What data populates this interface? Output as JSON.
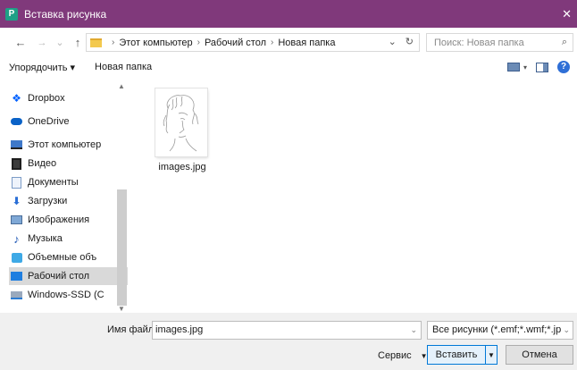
{
  "window": {
    "title": "Вставка рисунка",
    "app_icon_letter": "P",
    "close_glyph": "✕",
    "title_color": "#80397b"
  },
  "address": {
    "back_glyph": "←",
    "forward_glyph": "→",
    "recent_glyph": "⌄",
    "up_glyph": "↑",
    "crumbs": [
      "Этот компьютер",
      "Рабочий стол",
      "Новая папка"
    ],
    "separator": "›",
    "dropdown_glyph": "⌄",
    "refresh_glyph": "↻"
  },
  "search": {
    "placeholder": "Поиск: Новая папка",
    "icon": "⌕"
  },
  "toolbar": {
    "organize": "Упорядочить ▾",
    "new_folder": "Новая папка",
    "view_dd": "▾",
    "help": "?"
  },
  "sidebar": {
    "items": [
      {
        "label": "Dropbox",
        "icon": "dropbox-icon"
      },
      {
        "label": "OneDrive",
        "icon": "onedrive-icon"
      },
      {
        "label": "Этот компьютер",
        "icon": "computer-icon"
      },
      {
        "label": "Видео",
        "icon": "video-icon"
      },
      {
        "label": "Документы",
        "icon": "documents-icon"
      },
      {
        "label": "Загрузки",
        "icon": "downloads-icon"
      },
      {
        "label": "Изображения",
        "icon": "images-icon"
      },
      {
        "label": "Музыка",
        "icon": "music-icon"
      },
      {
        "label": "Объемные объ",
        "icon": "3d-objects-icon"
      },
      {
        "label": "Рабочий стол",
        "icon": "desktop-icon",
        "selected": true
      },
      {
        "label": "Windows-SSD (C",
        "icon": "drive-icon"
      }
    ],
    "scroll_up": "▲",
    "scroll_down": "▼"
  },
  "files": [
    {
      "name": "images.jpg"
    }
  ],
  "bottom": {
    "filename_label": "Имя файла:",
    "filename_value": "images.jpg",
    "filter_value": "Все рисунки (*.emf;*.wmf;*.jpg;",
    "dropdown_glyph": "⌄",
    "service": "Сервис",
    "service_arrow": "▼",
    "insert": "Вставить",
    "insert_arrow": "▼",
    "cancel": "Отмена"
  }
}
